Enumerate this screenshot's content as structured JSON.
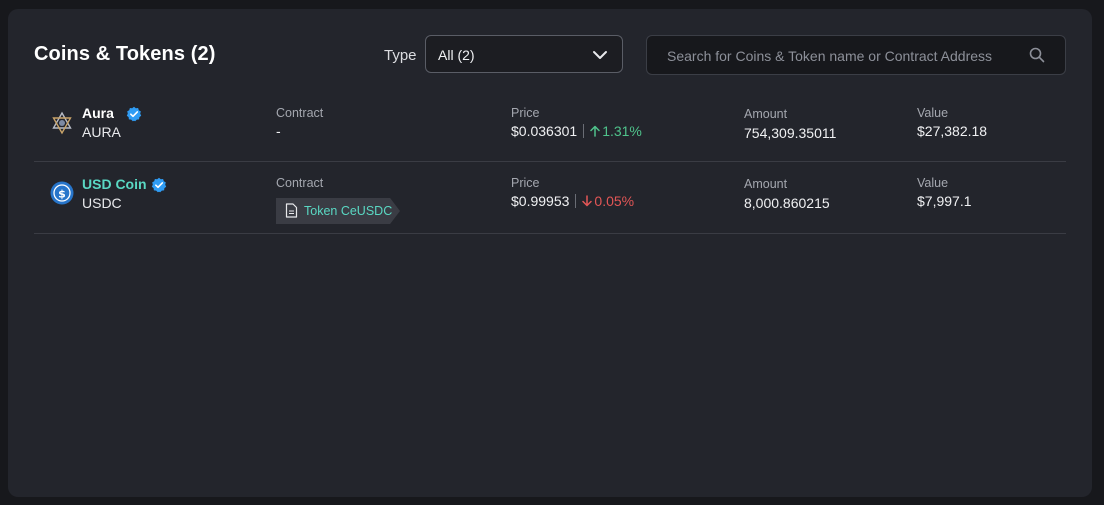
{
  "header": {
    "title": "Coins & Tokens (2)",
    "type_label": "Type",
    "type_value": "All (2)",
    "search_placeholder": "Search for Coins & Token name or Contract Address"
  },
  "labels": {
    "contract": "Contract",
    "price": "Price",
    "amount": "Amount",
    "value": "Value"
  },
  "rows": [
    {
      "name": "Aura",
      "symbol": "AURA",
      "contract": "-",
      "price": "$0.036301",
      "change": "1.31%",
      "change_direction": "up",
      "amount": "754,309.35011",
      "value": "$27,382.18",
      "name_color": "#ffffff"
    },
    {
      "name": "USD Coin",
      "symbol": "USDC",
      "contract_tag": "Token CeUSDC",
      "price": "$0.99953",
      "change": "0.05%",
      "change_direction": "down",
      "amount": "8,000.860215",
      "value": "$7,997.1",
      "name_color": "#5ad8c3"
    }
  ],
  "colors": {
    "accent": "#5ad8c3",
    "positive": "#4fc28b",
    "negative": "#e25656",
    "verified": "#2f9cf4"
  },
  "icons": [
    "aura-logo-icon",
    "usdc-logo-icon",
    "verified-badge-icon",
    "chevron-down-icon",
    "search-icon",
    "document-icon",
    "arrow-up-icon",
    "arrow-down-icon"
  ]
}
